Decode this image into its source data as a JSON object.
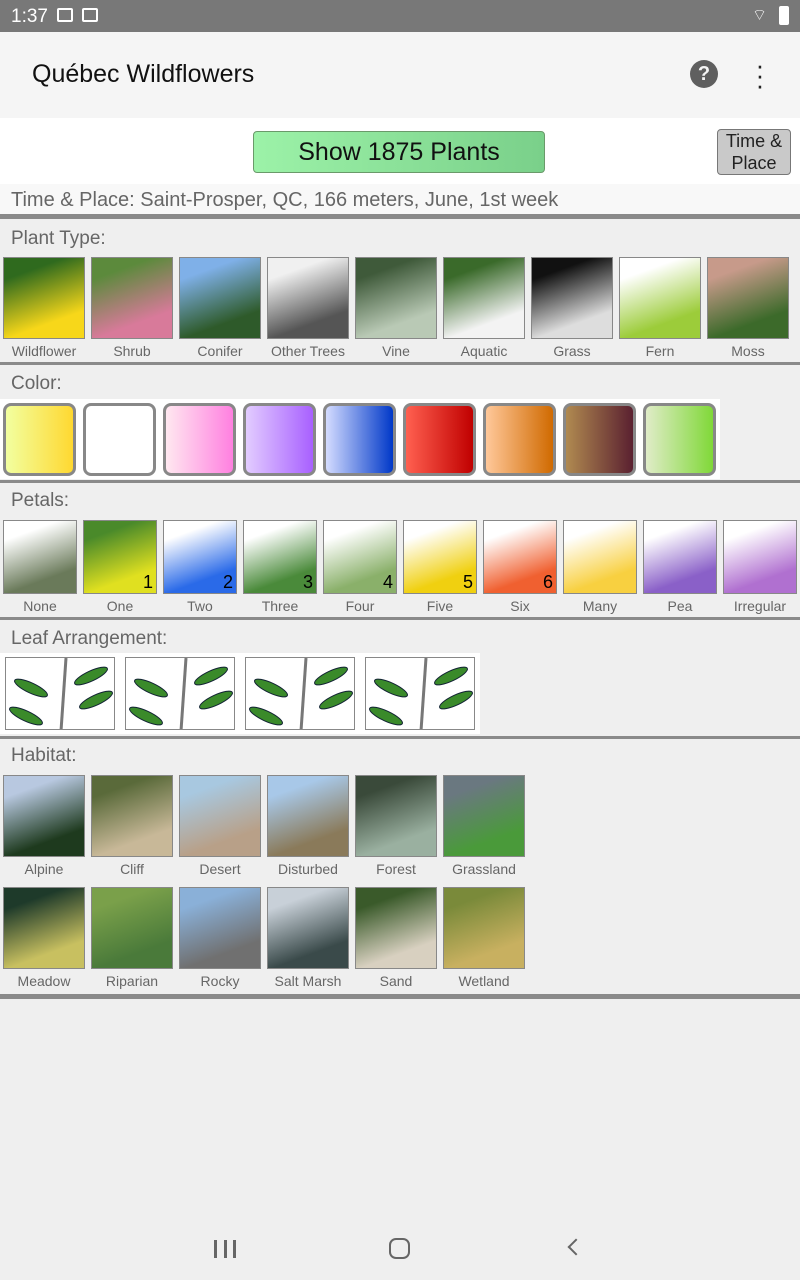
{
  "status": {
    "time": "1:37"
  },
  "app": {
    "title": "Québec Wildflowers"
  },
  "toolbar": {
    "show_label": "Show 1875 Plants",
    "time_place_label_1": "Time &",
    "time_place_label_2": "Place",
    "time_place_info": "Time & Place: Saint-Prosper, QC, 166 meters, June, 1st week"
  },
  "sections": {
    "plant_type": "Plant Type:",
    "color": "Color:",
    "petals": "Petals:",
    "leaf": "Leaf Arrangement:",
    "habitat": "Habitat:"
  },
  "plant_types": [
    {
      "label": "Wildflower",
      "thumb": [
        "#2f6a1e",
        "#f7d71a"
      ]
    },
    {
      "label": "Shrub",
      "thumb": [
        "#5c8a3c",
        "#d87a9a"
      ]
    },
    {
      "label": "Conifer",
      "thumb": [
        "#7fb0e8",
        "#2e5a2a"
      ]
    },
    {
      "label": "Other Trees",
      "thumb": [
        "#f0f0f0",
        "#555"
      ]
    },
    {
      "label": "Vine",
      "thumb": [
        "#3f5a3a",
        "#b9c9b5"
      ]
    },
    {
      "label": "Aquatic",
      "thumb": [
        "#3a6a2a",
        "#f3f3f3"
      ]
    },
    {
      "label": "Grass",
      "thumb": [
        "#111",
        "#ddd"
      ]
    },
    {
      "label": "Fern",
      "thumb": [
        "#fff",
        "#9ccc3a"
      ]
    },
    {
      "label": "Moss",
      "thumb": [
        "#c79a8a",
        "#3c6a2a"
      ]
    }
  ],
  "colors": [
    [
      "#f2ffa0",
      "#ffd830"
    ],
    [
      "#ffffff",
      "#ffffff"
    ],
    [
      "#ffe8f0",
      "#ff80e0"
    ],
    [
      "#e2ccff",
      "#a860ff"
    ],
    [
      "#d4dcff",
      "#0038c8"
    ],
    [
      "#ff6050",
      "#c00000"
    ],
    [
      "#ffc89a",
      "#d06a00"
    ],
    [
      "#b08a50",
      "#5a2030"
    ],
    [
      "#e0ecc8",
      "#80d838"
    ]
  ],
  "petals": [
    {
      "label": "None",
      "num": ""
    },
    {
      "label": "One",
      "num": "1"
    },
    {
      "label": "Two",
      "num": "2"
    },
    {
      "label": "Three",
      "num": "3"
    },
    {
      "label": "Four",
      "num": "4"
    },
    {
      "label": "Five",
      "num": "5"
    },
    {
      "label": "Six",
      "num": "6"
    },
    {
      "label": "Many",
      "num": ""
    },
    {
      "label": "Pea",
      "num": ""
    },
    {
      "label": "Irregular",
      "num": ""
    }
  ],
  "petal_thumbs": [
    [
      "#fff",
      "#6a7a5a"
    ],
    [
      "#4a8a2a",
      "#e0e020"
    ],
    [
      "#fff",
      "#2a6ae8"
    ],
    [
      "#fff",
      "#4a8a3a"
    ],
    [
      "#fff",
      "#8ab06a"
    ],
    [
      "#fff",
      "#f0d010"
    ],
    [
      "#fff",
      "#f06030"
    ],
    [
      "#fff",
      "#f8d040"
    ],
    [
      "#fff",
      "#8a60c8"
    ],
    [
      "#fff",
      "#b070d0"
    ]
  ],
  "leaf_arrangements": [
    "alternate",
    "opposite",
    "whorled",
    "palmate"
  ],
  "habitats": [
    {
      "label": "Alpine",
      "thumb": [
        "#b8c8e0",
        "#1e3a1e"
      ]
    },
    {
      "label": "Cliff",
      "thumb": [
        "#5a6a3a",
        "#c8b898"
      ]
    },
    {
      "label": "Desert",
      "thumb": [
        "#a8c8e0",
        "#b8a088"
      ]
    },
    {
      "label": "Disturbed",
      "thumb": [
        "#a8c8e8",
        "#8a7a5a"
      ]
    },
    {
      "label": "Forest",
      "thumb": [
        "#3a4a3a",
        "#9ab0a0"
      ]
    },
    {
      "label": "Grassland",
      "thumb": [
        "#6a7880",
        "#4a9a3a"
      ]
    },
    {
      "label": "Meadow",
      "thumb": [
        "#1e3a2a",
        "#c8c060"
      ]
    },
    {
      "label": "Riparian",
      "thumb": [
        "#7aa04a",
        "#4a7a3a"
      ]
    },
    {
      "label": "Rocky",
      "thumb": [
        "#8ab0d8",
        "#707070"
      ]
    },
    {
      "label": "Salt Marsh",
      "thumb": [
        "#c8d0d8",
        "#3a4a4a"
      ]
    },
    {
      "label": "Sand",
      "thumb": [
        "#3a5a2a",
        "#d8d0c0"
      ]
    },
    {
      "label": "Wetland",
      "thumb": [
        "#7a8a3a",
        "#c8b060"
      ]
    }
  ]
}
